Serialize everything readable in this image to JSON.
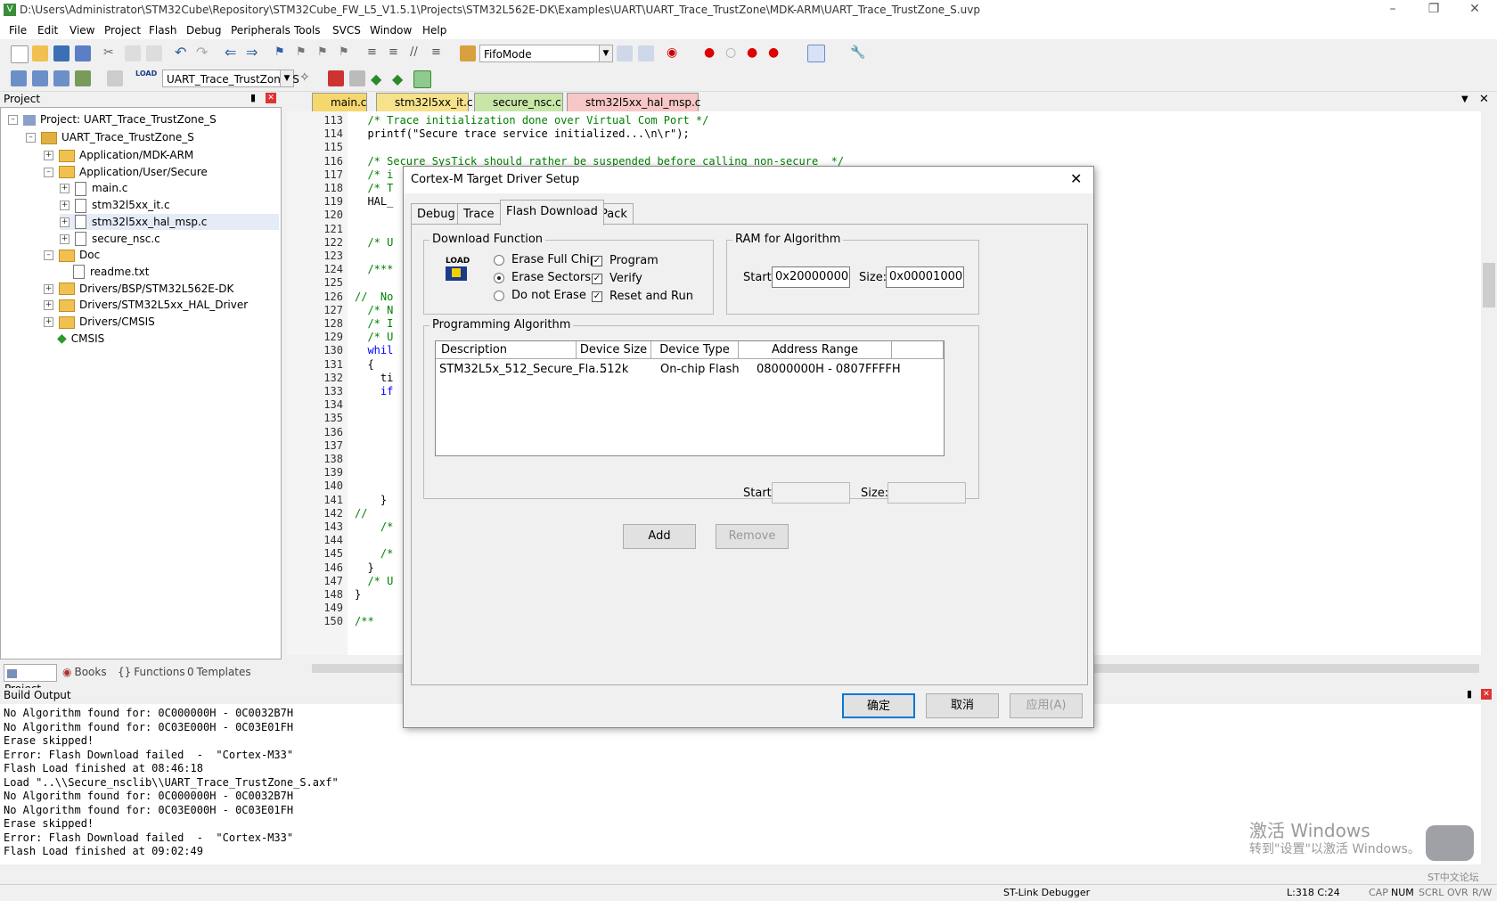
{
  "window": {
    "title": "D:\\Users\\Administrator\\STM32Cube\\Repository\\STM32Cube_FW_L5_V1.5.1\\Projects\\STM32L562E-DK\\Examples\\UART\\UART_Trace_TrustZone\\MDK-ARM\\UART_Trace_TrustZone_S.uvp"
  },
  "menu": [
    "File",
    "Edit",
    "View",
    "Project",
    "Flash",
    "Debug",
    "Peripherals",
    "Tools",
    "SVCS",
    "Window",
    "Help"
  ],
  "toolbar": {
    "find_combo": "FifoMode",
    "target_combo": "UART_Trace_TrustZone_S"
  },
  "project_panel": {
    "title": "Project",
    "root": "Project: UART_Trace_TrustZone_S",
    "target": "UART_Trace_TrustZone_S",
    "items": [
      {
        "label": "Application/MDK-ARM",
        "kind": "folder",
        "level": 2,
        "exp": "+"
      },
      {
        "label": "Application/User/Secure",
        "kind": "folder",
        "level": 2,
        "exp": "-"
      },
      {
        "label": "main.c",
        "kind": "file",
        "level": 3,
        "exp": "+"
      },
      {
        "label": "stm32l5xx_it.c",
        "kind": "file",
        "level": 3,
        "exp": "+"
      },
      {
        "label": "stm32l5xx_hal_msp.c",
        "kind": "file",
        "level": 3,
        "exp": "+"
      },
      {
        "label": "secure_nsc.c",
        "kind": "file",
        "level": 3,
        "exp": "+"
      },
      {
        "label": "Doc",
        "kind": "folder",
        "level": 2,
        "exp": "-"
      },
      {
        "label": "readme.txt",
        "kind": "file",
        "level": 3,
        "exp": ""
      },
      {
        "label": "Drivers/BSP/STM32L562E-DK",
        "kind": "folder",
        "level": 2,
        "exp": "+"
      },
      {
        "label": "Drivers/STM32L5xx_HAL_Driver",
        "kind": "folder",
        "level": 2,
        "exp": "+"
      },
      {
        "label": "Drivers/CMSIS",
        "kind": "folder",
        "level": 2,
        "exp": "+"
      },
      {
        "label": "CMSIS",
        "kind": "diamond",
        "level": 2,
        "exp": ""
      }
    ],
    "bottom_tabs": [
      "Project",
      "Books",
      "Functions",
      "Templates"
    ]
  },
  "editor_tabs": [
    {
      "label": "main.c",
      "color": "#f5d76e"
    },
    {
      "label": "stm32l5xx_it.c",
      "color": "#f5e28a"
    },
    {
      "label": "secure_nsc.c",
      "color": "#c8e6a8"
    },
    {
      "label": "stm32l5xx_hal_msp.c",
      "color": "#f7c6c6"
    }
  ],
  "code_lines": [
    {
      "n": "113",
      "t": "  /* Trace initialization done over Virtual Com Port */",
      "c": "cm"
    },
    {
      "n": "114",
      "t": "  printf(\"Secure trace service initialized...\\n\\r\");",
      "c": ""
    },
    {
      "n": "115",
      "t": "",
      "c": ""
    },
    {
      "n": "116",
      "t": "  /* Secure SysTick should rather be suspended before calling non-secure  */",
      "c": "cm"
    },
    {
      "n": "117",
      "t": "  /* i",
      "c": "cm"
    },
    {
      "n": "118",
      "t": "  /* T",
      "c": "cm"
    },
    {
      "n": "119",
      "t": "  HAL_",
      "c": ""
    },
    {
      "n": "120",
      "t": "",
      "c": ""
    },
    {
      "n": "121",
      "t": "",
      "c": ""
    },
    {
      "n": "122",
      "t": "  /* U",
      "c": "cm"
    },
    {
      "n": "123",
      "t": "",
      "c": ""
    },
    {
      "n": "124",
      "t": "  /***",
      "c": "cm"
    },
    {
      "n": "125",
      "t": "",
      "c": ""
    },
    {
      "n": "126",
      "t": "//  No",
      "c": "cm"
    },
    {
      "n": "127",
      "t": "  /* N",
      "c": "cm"
    },
    {
      "n": "128",
      "t": "  /* I",
      "c": "cm"
    },
    {
      "n": "129",
      "t": "  /* U",
      "c": "cm"
    },
    {
      "n": "130",
      "t": "  whil",
      "c": "kw"
    },
    {
      "n": "131",
      "t": "  {",
      "c": ""
    },
    {
      "n": "132",
      "t": "    ti",
      "c": ""
    },
    {
      "n": "133",
      "t": "    if",
      "c": "kw"
    },
    {
      "n": "134",
      "t": "",
      "c": ""
    },
    {
      "n": "135",
      "t": "",
      "c": ""
    },
    {
      "n": "136",
      "t": "",
      "c": ""
    },
    {
      "n": "137",
      "t": "",
      "c": ""
    },
    {
      "n": "138",
      "t": "",
      "c": ""
    },
    {
      "n": "139",
      "t": "",
      "c": ""
    },
    {
      "n": "140",
      "t": "",
      "c": ""
    },
    {
      "n": "141",
      "t": "    }",
      "c": ""
    },
    {
      "n": "142",
      "t": "//",
      "c": "cm"
    },
    {
      "n": "143",
      "t": "    /*",
      "c": "cm"
    },
    {
      "n": "144",
      "t": "",
      "c": ""
    },
    {
      "n": "145",
      "t": "    /*",
      "c": "cm"
    },
    {
      "n": "146",
      "t": "  }",
      "c": ""
    },
    {
      "n": "147",
      "t": "  /* U",
      "c": "cm"
    },
    {
      "n": "148",
      "t": "}",
      "c": ""
    },
    {
      "n": "149",
      "t": "",
      "c": ""
    },
    {
      "n": "150",
      "t": "/**",
      "c": "cm"
    }
  ],
  "build_output": {
    "title": "Build Output",
    "lines": [
      "No Algorithm found for: 0C000000H - 0C0032B7H",
      "No Algorithm found for: 0C03E000H - 0C03E01FH",
      "Erase skipped!",
      "Error: Flash Download failed  -  \"Cortex-M33\"",
      "Flash Load finished at 08:46:18",
      "Load \"..\\\\Secure_nsclib\\\\UART_Trace_TrustZone_S.axf\"",
      "No Algorithm found for: 0C000000H - 0C0032B7H",
      "No Algorithm found for: 0C03E000H - 0C03E01FH",
      "Erase skipped!",
      "Error: Flash Download failed  -  \"Cortex-M33\"",
      "Flash Load finished at 09:02:49"
    ]
  },
  "status": {
    "debugger": "ST-Link Debugger",
    "position": "L:318 C:24",
    "cap": "CAP",
    "num": "NUM",
    "scrl": "SCRL",
    "ovr": "OVR",
    "rw": "R/W"
  },
  "watermark": {
    "line1": "激活 Windows",
    "line2": "转到\"设置\"以激活 Windows。",
    "badge": "ST中文论坛"
  },
  "dialog": {
    "title": "Cortex-M Target Driver Setup",
    "tabs": [
      "Debug",
      "Trace",
      "Flash Download",
      "Pack"
    ],
    "active_tab": "Flash Download",
    "download_function": {
      "label": "Download Function",
      "icon_text": "LOAD",
      "erase_options": [
        "Erase Full Chip",
        "Erase Sectors",
        "Do not Erase"
      ],
      "erase_selected": "Erase Sectors",
      "checks": [
        {
          "label": "Program",
          "checked": true
        },
        {
          "label": "Verify",
          "checked": true
        },
        {
          "label": "Reset and Run",
          "checked": true
        }
      ]
    },
    "ram": {
      "label": "RAM for Algorithm",
      "start_label": "Start:",
      "start_value": "0x20000000",
      "size_label": "Size:",
      "size_value": "0x00001000"
    },
    "algorithm": {
      "label": "Programming Algorithm",
      "columns": [
        "Description",
        "Device Size",
        "Device Type",
        "Address Range"
      ],
      "rows": [
        [
          "STM32L5x_512_Secure_Fla...",
          "512k",
          "On-chip Flash",
          "08000000H - 0807FFFFH"
        ]
      ],
      "start_label": "Start:",
      "start_value": "",
      "size_label": "Size:",
      "size_value": ""
    },
    "buttons": {
      "add": "Add",
      "remove": "Remove",
      "ok": "确定",
      "cancel": "取消",
      "apply": "应用(A)"
    }
  }
}
